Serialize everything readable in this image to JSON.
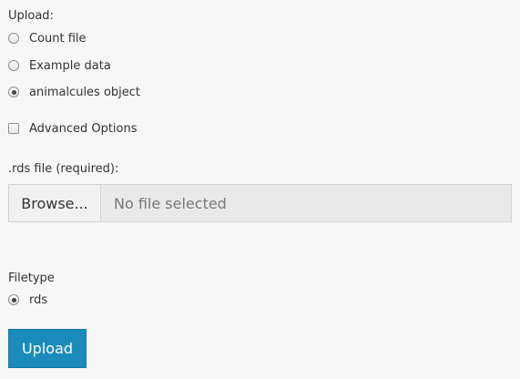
{
  "upload": {
    "label": "Upload:",
    "options": [
      {
        "label": "Count file",
        "checked": false
      },
      {
        "label": "Example data",
        "checked": false
      },
      {
        "label": "animalcules object",
        "checked": true
      }
    ]
  },
  "advanced": {
    "label": "Advanced Options",
    "checked": false
  },
  "rds": {
    "label": ".rds file (required):",
    "browse_label": "Browse...",
    "file_status": "No file selected"
  },
  "filetype": {
    "label": "Filetype",
    "options": [
      {
        "label": "rds",
        "checked": true
      }
    ]
  },
  "submit": {
    "label": "Upload"
  },
  "colors": {
    "primary_button": "#1a8bbb",
    "background": "#f7f7f7"
  }
}
